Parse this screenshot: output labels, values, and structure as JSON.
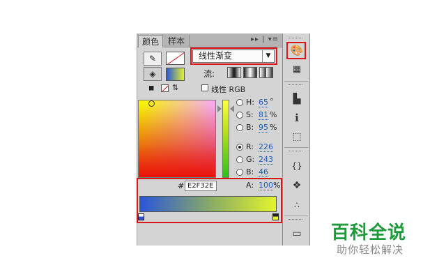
{
  "tabs": {
    "color": "颜色",
    "swatches": "样本",
    "controls": "▸▸ | ▾≡"
  },
  "fill_type": {
    "selected": "线性渐变",
    "arrow": "▼"
  },
  "flow_label": "流:",
  "linear_rgb_label": "线性 RGB",
  "hsb": {
    "h_label": "H:",
    "h_value": "65",
    "h_unit": "°",
    "s_label": "S:",
    "s_value": "81",
    "s_unit": "%",
    "b_label": "B:",
    "b_value": "95",
    "b_unit": "%"
  },
  "rgb": {
    "r_label": "R:",
    "r_value": "226",
    "g_label": "G:",
    "g_value": "243",
    "b_label": "B:",
    "b_value": "46"
  },
  "hex": {
    "prefix": "#",
    "value": "E2F32E"
  },
  "alpha": {
    "label": "A:",
    "value": "100",
    "unit": "%"
  },
  "gradient_stops": [
    {
      "color": "#2b56d8",
      "position": 0
    },
    {
      "color": "#e2f32e",
      "position": 1
    }
  ],
  "colors": {
    "current": "#e2f32e",
    "accent_red": "#d9171b"
  },
  "icons": [
    "color-palette-icon",
    "swatch-grid-icon",
    "align-icon",
    "info-icon",
    "transform-icon",
    "code-icon",
    "components-icon",
    "motion-icon",
    "library-icon"
  ],
  "watermark": {
    "title": "百科全说",
    "subtitle": "助你轻松解决"
  }
}
